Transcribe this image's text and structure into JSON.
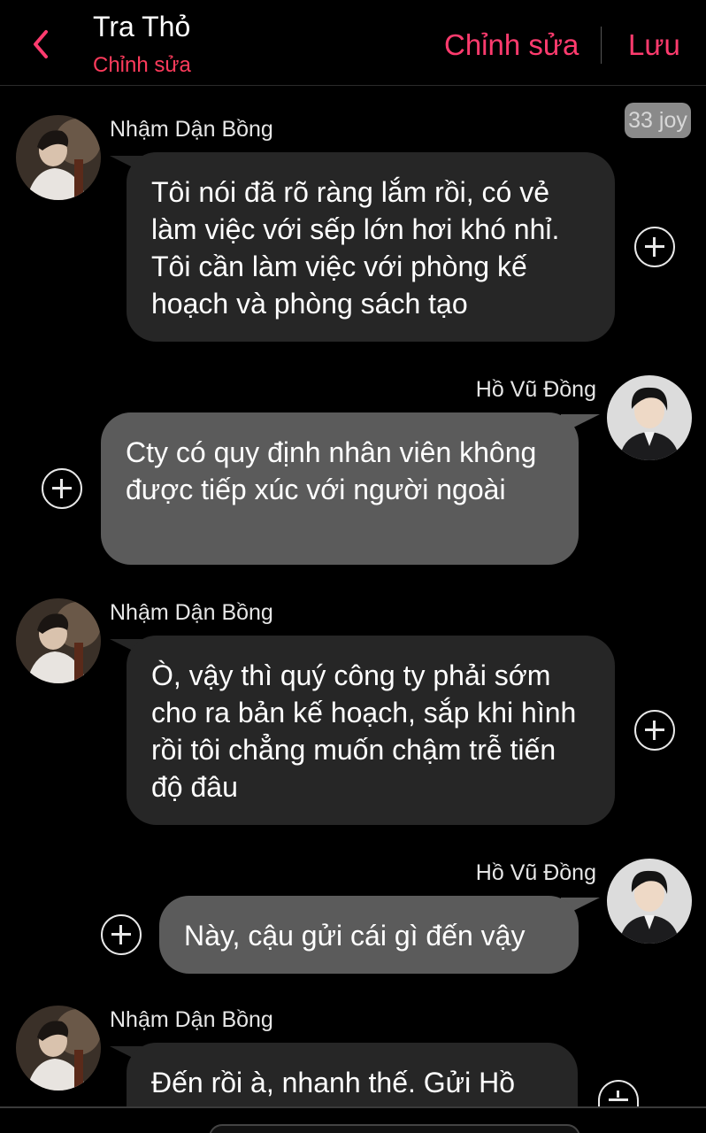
{
  "header": {
    "title": "Tra Thỏ",
    "subtitle": "Chỉnh sửa",
    "edit_label": "Chỉnh sửa",
    "save_label": "Lưu"
  },
  "badge": "33 joy",
  "messages": [
    {
      "sender": "Nhậm Dận Bồng",
      "side": "left",
      "text": "Tôi nói đã rõ ràng lắm rồi, có vẻ làm việc với sếp lớn hơi khó nhỉ. Tôi cần làm việc với phòng kế hoạch và phòng sách tạo"
    },
    {
      "sender": "Hồ Vũ Đồng",
      "side": "right",
      "text": "Cty có quy định nhân viên không được tiếp xúc với người ngoài"
    },
    {
      "sender": "Nhậm Dận Bồng",
      "side": "left",
      "text": "Ò, vậy thì quý công ty phải sớm cho ra bản kế hoạch, sắp khi hình rồi tôi chẳng muốn chậm trễ tiến độ đâu"
    },
    {
      "sender": "Hồ Vũ Đồng",
      "side": "right",
      "text": "Này, cậu gửi cái gì đến vậy"
    },
    {
      "sender": "Nhậm Dận Bồng",
      "side": "left",
      "text": "Đến rồi à, nhanh thế. Gửi Hồ"
    }
  ],
  "colors": {
    "accent": "#ff3b6e",
    "left_bubble": "#262626",
    "right_bubble": "#5b5b5b",
    "background": "#000000"
  }
}
